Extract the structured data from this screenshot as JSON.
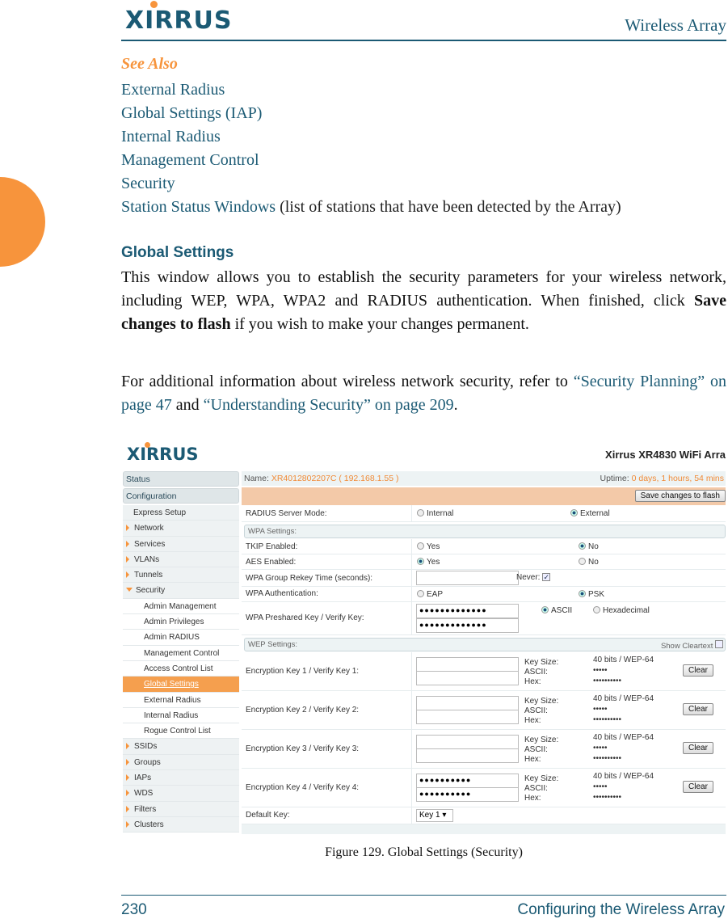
{
  "header": {
    "logo": "XIRRUS",
    "title": "Wireless Array"
  },
  "see_also": {
    "heading": "See Also",
    "links": [
      "External Radius",
      "Global Settings (IAP)",
      "Internal Radius",
      "Management Control",
      "Security",
      "Station Status Windows"
    ],
    "last_suffix": " (list of stations that have been detected by the Array)"
  },
  "section": {
    "heading": "Global Settings",
    "p1_a": "This window allows you to establish the security parameters for your wireless network, including WEP, WPA, WPA2 and RADIUS authentication. When finished, click ",
    "p1_bold": "Save changes to flash",
    "p1_b": " if you wish to make your changes permanent.",
    "p2_a": "For additional information about wireless network security, refer to ",
    "p2_link1": "“Security Planning” on page 47",
    "p2_mid": " and ",
    "p2_link2": "“Understanding Security” on page 209",
    "p2_end": "."
  },
  "figure": {
    "logo": "XIRRUS",
    "title": "Xirrus XR4830 WiFi Arra",
    "name_label": "Name: ",
    "name_value": "XR4012802207C   ( 192.168.1.55 )",
    "uptime_label": "Uptime: ",
    "uptime_value": "0 days, 1 hours, 54 mins",
    "save_button": "Save changes to flash",
    "sidebar": {
      "headers": [
        "Status",
        "Configuration"
      ],
      "items": [
        {
          "label": "Express Setup",
          "type": "plain"
        },
        {
          "label": "Network",
          "type": "collapsed"
        },
        {
          "label": "Services",
          "type": "collapsed"
        },
        {
          "label": "VLANs",
          "type": "collapsed"
        },
        {
          "label": "Tunnels",
          "type": "collapsed"
        },
        {
          "label": "Security",
          "type": "expanded"
        },
        {
          "label": "Admin Management",
          "type": "sub"
        },
        {
          "label": "Admin Privileges",
          "type": "sub"
        },
        {
          "label": "Admin RADIUS",
          "type": "sub"
        },
        {
          "label": "Management Control",
          "type": "sub"
        },
        {
          "label": "Access Control List",
          "type": "sub"
        },
        {
          "label": "Global Settings",
          "type": "sub",
          "selected": true
        },
        {
          "label": "External Radius",
          "type": "sub"
        },
        {
          "label": "Internal Radius",
          "type": "sub"
        },
        {
          "label": "Rogue Control List",
          "type": "sub"
        },
        {
          "label": "SSIDs",
          "type": "collapsed"
        },
        {
          "label": "Groups",
          "type": "collapsed"
        },
        {
          "label": "IAPs",
          "type": "collapsed"
        },
        {
          "label": "WDS",
          "type": "collapsed"
        },
        {
          "label": "Filters",
          "type": "collapsed"
        },
        {
          "label": "Clusters",
          "type": "collapsed"
        }
      ]
    },
    "radius_mode": {
      "label": "RADIUS Server Mode:",
      "options": [
        "Internal",
        "External"
      ],
      "selected": 1
    },
    "wpa": {
      "heading": "WPA Settings:",
      "tkip": {
        "label": "TKIP Enabled:",
        "options": [
          "Yes",
          "No"
        ],
        "selected": 1
      },
      "aes": {
        "label": "AES Enabled:",
        "options": [
          "Yes",
          "No"
        ],
        "selected": 0
      },
      "rekey": {
        "label": "WPA Group Rekey Time (seconds):",
        "value": "",
        "never_label": "Never:",
        "never_checked": true
      },
      "auth": {
        "label": "WPA Authentication:",
        "options": [
          "EAP",
          "PSK"
        ],
        "selected": 1
      },
      "psk": {
        "label": "WPA Preshared Key / Verify Key:",
        "key": "●●●●●●●●●●●●●",
        "verify": "●●●●●●●●●●●●●",
        "options": [
          "ASCII",
          "Hexadecimal"
        ],
        "selected": 0
      }
    },
    "wep": {
      "heading": "WEP Settings:",
      "show_cleartext": "Show Cleartext",
      "show_cleartext_checked": false,
      "info_labels": [
        "Key Size:",
        "ASCII:",
        "Hex:"
      ],
      "clear_label": "Clear",
      "keys": [
        {
          "label": "Encryption Key 1 / Verify Key 1:",
          "key": "",
          "verify": "",
          "size": "40 bits / WEP-64",
          "ascii": "•••••",
          "hex": "••••••••••"
        },
        {
          "label": "Encryption Key 2 / Verify Key 2:",
          "key": "",
          "verify": "",
          "size": "40 bits / WEP-64",
          "ascii": "•••••",
          "hex": "••••••••••"
        },
        {
          "label": "Encryption Key 3 / Verify Key 3:",
          "key": "",
          "verify": "",
          "size": "40 bits / WEP-64",
          "ascii": "•••••",
          "hex": "••••••••••"
        },
        {
          "label": "Encryption Key 4 / Verify Key 4:",
          "key": "●●●●●●●●●●",
          "verify": "●●●●●●●●●●",
          "size": "40 bits / WEP-64",
          "ascii": "•••••",
          "hex": "••••••••••"
        }
      ],
      "default_key": {
        "label": "Default Key:",
        "value": "Key 1"
      }
    }
  },
  "caption": "Figure 129. Global Settings (Security)",
  "footer": {
    "page": "230",
    "chapter": "Configuring the Wireless Array"
  },
  "colors": {
    "brand": "#1b5a74",
    "accent": "#f7943c"
  }
}
